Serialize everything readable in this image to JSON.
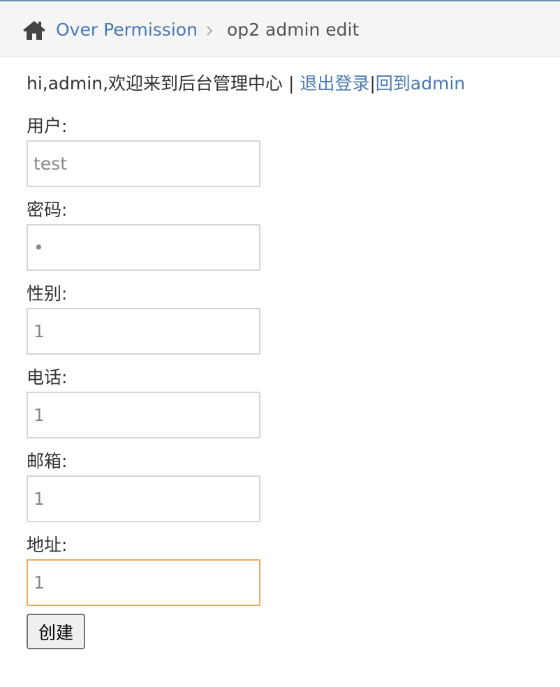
{
  "breadcrumb": {
    "home_icon": "home-icon",
    "section_link": "Over Permission",
    "separator_icon": "chevron-right-icon",
    "current": "op2 admin edit"
  },
  "welcome": {
    "greeting": "hi,admin,欢迎来到后台管理中心 | ",
    "logout_link": "退出登录",
    "divider": "|",
    "back_link": "回到admin"
  },
  "form": {
    "fields": [
      {
        "label": "用户:",
        "value": "test"
      },
      {
        "label": "密码:",
        "value": "•"
      },
      {
        "label": "性别:",
        "value": "1"
      },
      {
        "label": "电话:",
        "value": "1"
      },
      {
        "label": "邮箱:",
        "value": "1"
      },
      {
        "label": "地址:",
        "value": "1"
      }
    ],
    "submit_label": "创建"
  },
  "colors": {
    "link": "#4a7ab3",
    "focus_border": "#f0ab62",
    "top_border": "#6a8fb3"
  }
}
